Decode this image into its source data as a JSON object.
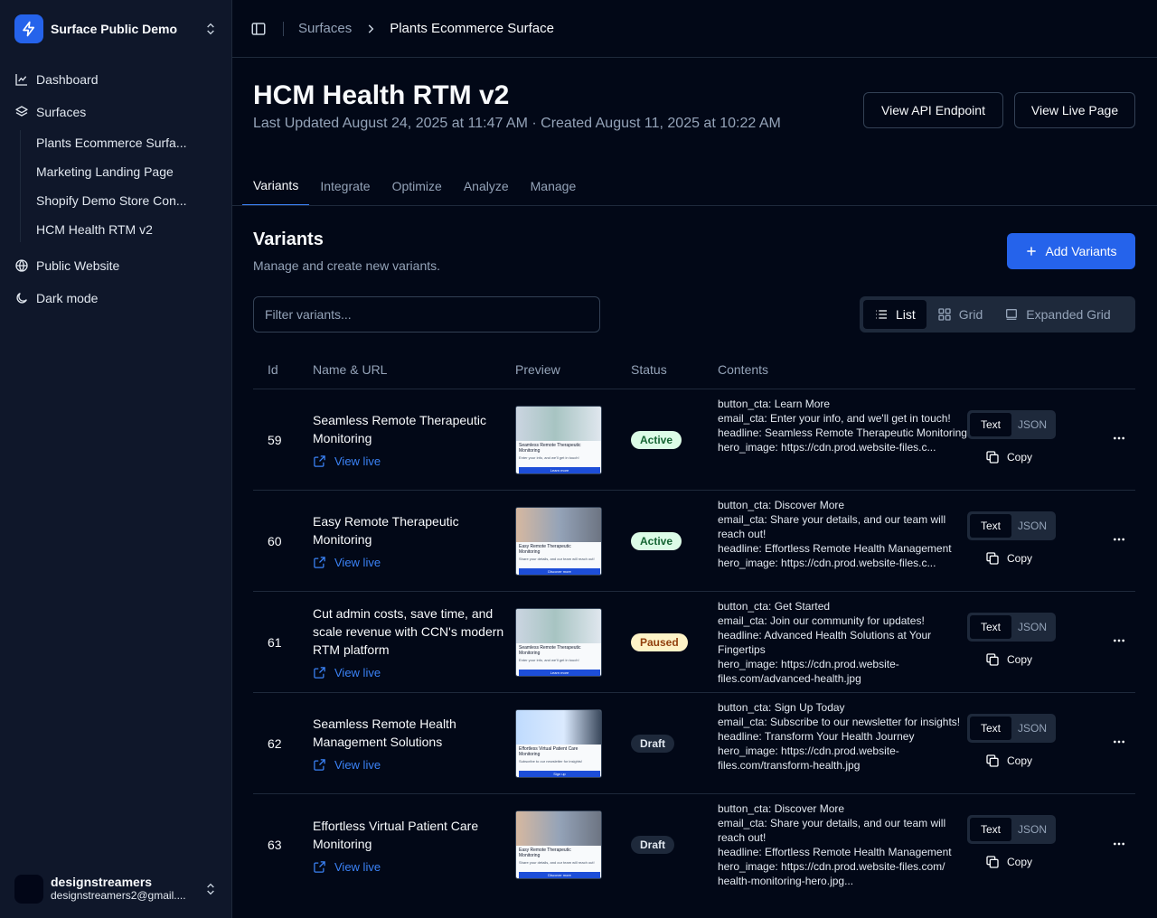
{
  "sidebar": {
    "org_name": "Surface Public Demo",
    "nav": {
      "dashboard": "Dashboard",
      "surfaces": "Surfaces",
      "public_website": "Public Website",
      "dark_mode": "Dark mode"
    },
    "surfaces": [
      "Plants Ecommerce Surfa...",
      "Marketing Landing Page",
      "Shopify Demo Store Con...",
      "HCM Health RTM v2"
    ],
    "user": {
      "name": "designstreamers",
      "email": "designstreamers2@gmail...."
    }
  },
  "breadcrumb": {
    "parent": "Surfaces",
    "current": "Plants Ecommerce Surface"
  },
  "header": {
    "title": "HCM Health RTM v2",
    "subtitle": "Last Updated August 24, 2025 at 11:47 AM · Created August 11, 2025 at 10:22 AM",
    "api_button": "View API Endpoint",
    "live_button": "View Live Page"
  },
  "tabs": [
    "Variants",
    "Integrate",
    "Optimize",
    "Analyze",
    "Manage"
  ],
  "variants_section": {
    "title": "Variants",
    "subtitle": "Manage and create new variants.",
    "add_button": "Add Variants",
    "filter_placeholder": "Filter variants...",
    "views": {
      "list": "List",
      "grid": "Grid",
      "expanded": "Expanded Grid"
    }
  },
  "table": {
    "columns": {
      "id": "Id",
      "name": "Name & URL",
      "preview": "Preview",
      "status": "Status",
      "contents": "Contents"
    },
    "view_live": "View live",
    "format_text": "Text",
    "format_json": "JSON",
    "copy": "Copy",
    "rows": [
      {
        "id": "59",
        "name": "Seamless Remote Therapeutic Monitoring",
        "status": "Active",
        "preview_title": "Seamless Remote Therapeutic Monitoring",
        "preview_sub": "Enter your info, and we'll get in touch!",
        "preview_btn": "Learn more",
        "contents": [
          "button_cta: Learn More",
          "email_cta: Enter your info, and we'll get in touch!",
          "headline: Seamless Remote Therapeutic Monitoring",
          "hero_image: https://cdn.prod.website-files.c..."
        ]
      },
      {
        "id": "60",
        "name": "Easy Remote Therapeutic Monitoring",
        "status": "Active",
        "preview_title": "Easy Remote Therapeutic Monitoring",
        "preview_sub": "Share your details, and our team will reach out!",
        "preview_btn": "Discover more",
        "contents": [
          "button_cta: Discover More",
          "email_cta: Share your details, and our team will reach out!",
          "headline: Effortless Remote Health Management",
          "hero_image: https://cdn.prod.website-files.c..."
        ]
      },
      {
        "id": "61",
        "name": "Cut admin costs, save time, and scale revenue with CCN's modern RTM platform",
        "status": "Paused",
        "preview_title": "Seamless Remote Therapeutic Monitoring",
        "preview_sub": "Enter your info, and we'll get in touch!",
        "preview_btn": "Learn more",
        "contents": [
          "button_cta: Get Started",
          "email_cta: Join our community for updates!",
          "headline: Advanced Health Solutions at Your Fingertips",
          "hero_image: https://cdn.prod.website-files.com/advanced-health.jpg"
        ]
      },
      {
        "id": "62",
        "name": "Seamless Remote Health Management Solutions",
        "status": "Draft",
        "preview_title": "Effortless Virtual Patient Care Monitoring",
        "preview_sub": "Subscribe to our newsletter for insights!",
        "preview_btn": "Sign up",
        "contents": [
          "button_cta: Sign Up Today",
          "email_cta: Subscribe to our newsletter for insights!",
          "headline: Transform Your Health Journey",
          "hero_image: https://cdn.prod.website-files.com/transform-health.jpg"
        ]
      },
      {
        "id": "63",
        "name": "Effortless Virtual Patient Care Monitoring",
        "status": "Draft",
        "preview_title": "Easy Remote Therapeutic Monitoring",
        "preview_sub": "Share your details, and our team will reach out!",
        "preview_btn": "Discover more",
        "contents": [
          "button_cta: Discover More",
          "email_cta: Share your details, and our team will reach out!",
          "headline: Effortless Remote Health Management",
          "hero_image: https://cdn.prod.website-files.com/ health-monitoring-hero.jpg..."
        ]
      }
    ]
  },
  "colors": {
    "background": "#020817",
    "sidebar": "#0f172a",
    "accent": "#2563eb",
    "active_badge": "#dcfce7",
    "paused_badge": "#fef3c7"
  }
}
